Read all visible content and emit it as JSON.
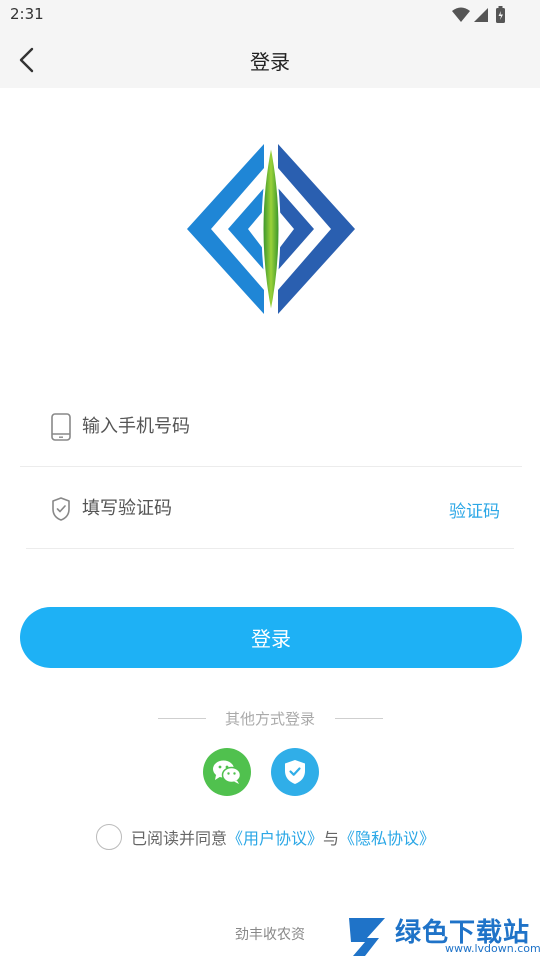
{
  "status_bar": {
    "time": "2:31"
  },
  "nav": {
    "title": "登录"
  },
  "form": {
    "phone_placeholder": "输入手机号码",
    "code_placeholder": "填写验证码",
    "get_code_label": "验证码",
    "login_label": "登录"
  },
  "other_login": {
    "title": "其他方式登录"
  },
  "agreement": {
    "prefix": "已阅读并同意",
    "user_agreement": "《用户协议》",
    "and": "与",
    "privacy_policy": "《隐私协议》"
  },
  "footer": {
    "app_name": "劲丰收农资"
  },
  "watermark": {
    "text": "绿色下载站",
    "url": "www.lvdown.com"
  },
  "colors": {
    "primary": "#1eb1f5",
    "link": "#2ba7e6",
    "wechat": "#50c14e",
    "shield": "#30aee8"
  }
}
